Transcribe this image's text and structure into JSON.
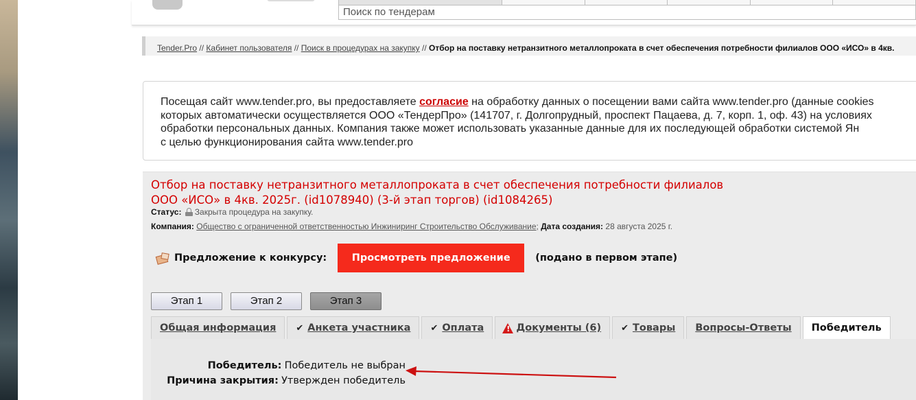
{
  "header": {
    "search_placeholder": "Поиск по тендерам"
  },
  "breadcrumb": {
    "items": [
      "Tender.Pro",
      "Кабинет пользователя",
      "Поиск в процедурах на закупку"
    ],
    "separator": "//",
    "current": "Отбор на поставку нетранзитного металлопроката в счет обеспечения потребности филиалов ООО «ИСО» в 4кв."
  },
  "consent": {
    "line1_before": "Посещая сайт www.tender.pro, вы предоставляете ",
    "link": "согласие",
    "line1_after": " на обработку данных о посещении вами сайта www.tender.pro (данные cookies",
    "line2": "которых автоматически осуществляется ООО «ТендерПро» (141707, г. Долгопрудный, проспект Пацаева, д. 7, корп. 1, оф. 43) на условиях",
    "line3": "обработки персональных данных. Компания также может использовать указанные данные для их последующей обработки системой Ян",
    "line4": "с целью функционирования сайта www.tender.pro"
  },
  "tender": {
    "title_line1": "Отбор на поставку нетранзитного металлопроката в счет обеспечения потребности филиалов",
    "title_line2": "ООО «ИСО» в 4кв. 2025г. (id1078940) (3-й этап торгов) (id1084265)",
    "status_label": "Статус:",
    "status_value": "Закрыта процедура на закупку.",
    "company_label": "Компания:",
    "company_value": "Общество с ограниченной ответственностью Инжиниринг Строительство Обслуживание",
    "company_sep": ";",
    "created_label": "Дата создания:",
    "created_value": "28 августа 2025 г."
  },
  "offer": {
    "label": "Предложение к конкурсу:",
    "button": "Просмотреть предложение",
    "note": "(подано в первом этапе)",
    "button_color": "#f52a1c"
  },
  "stages": [
    "Этап 1",
    "Этап 2",
    "Этап 3"
  ],
  "active_stage": "Этап 3",
  "tabs": [
    {
      "label": "Общая информация",
      "icon": ""
    },
    {
      "label": "Анкета участника",
      "icon": "check-icon"
    },
    {
      "label": "Оплата",
      "icon": "check-icon"
    },
    {
      "label": "Документы (6)",
      "icon": "warning-icon"
    },
    {
      "label": "Товары",
      "icon": "check-icon"
    },
    {
      "label": "Вопросы-Ответы",
      "icon": ""
    },
    {
      "label": "Победитель",
      "icon": ""
    }
  ],
  "active_tab": "Победитель",
  "winner": {
    "label": "Победитель:",
    "value": "Победитель не выбран",
    "reason_label": "Причина закрытия:",
    "reason_value": "Утвержден победитель"
  },
  "colors": {
    "title": "#d40000",
    "accent_button": "#f52a1c",
    "annotation_arrow": "#cc1111"
  }
}
